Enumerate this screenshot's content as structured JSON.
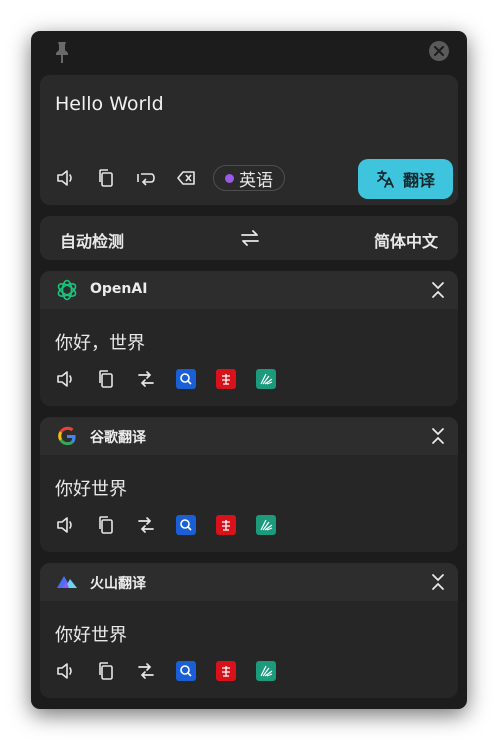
{
  "window": {
    "close_icon": "close-icon",
    "pin_icon": "pin-icon"
  },
  "input": {
    "text": "Hello World",
    "detected_lang": "英语",
    "detected_dot_color": "#9b59e8"
  },
  "toolbar": {
    "translate_label": "翻译",
    "accent_color": "#3ec5dd"
  },
  "languages": {
    "source": "自动检测",
    "target": "简体中文"
  },
  "results": [
    {
      "service": "OpenAI",
      "text": "你好，世界",
      "icon": "openai-icon"
    },
    {
      "service": "谷歌翻译",
      "text": "你好世界",
      "icon": "google-icon"
    },
    {
      "service": "火山翻译",
      "text": "你好世界",
      "icon": "volcano-icon"
    }
  ]
}
